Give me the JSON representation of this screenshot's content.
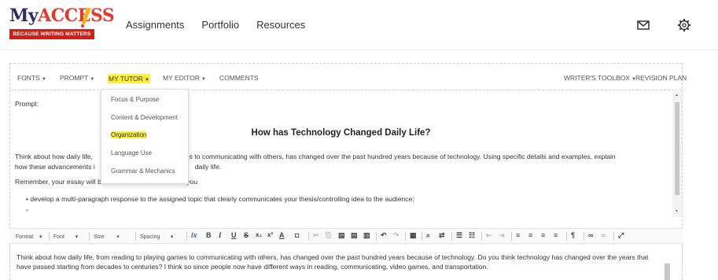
{
  "brand": {
    "name_part1": "My",
    "name_part2": "ACCESS",
    "tagline": "BECAUSE WRITING MATTERS"
  },
  "nav": {
    "items": [
      "Assignments",
      "Portfolio",
      "Resources"
    ]
  },
  "header_icons": [
    "mail-icon",
    "gear-icon"
  ],
  "menubar": {
    "fonts": "FONTS",
    "prompt": "PROMPT",
    "my_tutor": "MY TUTOR",
    "my_editor": "MY EDITOR",
    "comments": "COMMENTS",
    "writers_toolbox": "WRITER'S TOOLBOX",
    "revision_plan": "REVISION PLAN",
    "caret": "▼"
  },
  "dropdown": {
    "items": [
      "Focus & Purpose",
      "Content & Development",
      "Organization",
      "Language Use",
      "Grammar & Mechanics"
    ],
    "highlighted": "Organization"
  },
  "prompt": {
    "label": "Prompt:",
    "title": "How has Technology Changed Daily Life?",
    "para1_line1_a": "Think about how daily life,",
    "para1_line1_b": "es to communicating with others, has changed over the past hundred years because of technology. Using specific details and examples, explain",
    "para1_line2_a": "how these advancements i",
    "para1_line2_b": "daily life.",
    "para2": "Remember, your essay will be scored based on how well you",
    "bullet1": "develop a multi-paragraph response to the assigned topic that clearly communicates your thesis/controlling idea to the audience;"
  },
  "toolbar": {
    "format": "Format",
    "font": "Font",
    "size": "Size",
    "spacing": "Spacing",
    "dropdown_caret": "▾"
  },
  "essay": {
    "text": "Think about how daily life, from reading to playing games to communicating with others, has changed over the past hundred years because of technology. Do you think technology has changed over the years that have passed starting from decades to centuries? I  think so since people now have different ways in reading, communicating, video games, and transportation."
  },
  "colors": {
    "highlight": "#ffef3a",
    "brand_red": "#c8231d",
    "brand_navy": "#2b2f6b"
  }
}
